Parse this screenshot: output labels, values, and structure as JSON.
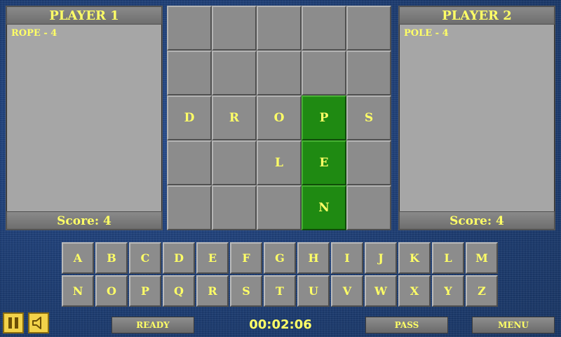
{
  "player1": {
    "title": "PLAYER 1",
    "words": [
      "ROPE - 4"
    ],
    "score": "Score: 4"
  },
  "player2": {
    "title": "PLAYER 2",
    "words": [
      "POLE - 4"
    ],
    "score": "Score: 4"
  },
  "board": {
    "rows": [
      [
        "",
        "",
        "",
        "",
        ""
      ],
      [
        "",
        "",
        "",
        "",
        ""
      ],
      [
        "D",
        "R",
        "O",
        "P",
        "S"
      ],
      [
        "",
        "",
        "L",
        "E",
        ""
      ],
      [
        "",
        "",
        "",
        "N",
        ""
      ]
    ],
    "highlighted": [
      [
        2,
        3
      ],
      [
        3,
        3
      ],
      [
        4,
        3
      ]
    ]
  },
  "keyboard": {
    "rows": [
      [
        "A",
        "B",
        "C",
        "D",
        "E",
        "F",
        "G",
        "H",
        "I",
        "J",
        "K",
        "L",
        "M"
      ],
      [
        "N",
        "O",
        "P",
        "Q",
        "R",
        "S",
        "T",
        "U",
        "V",
        "W",
        "X",
        "Y",
        "Z"
      ]
    ]
  },
  "controls": {
    "pause_icon": "pause-icon",
    "sound_icon": "speaker-icon",
    "ready_label": "READY",
    "timer": "00:02:06",
    "pass_label": "PASS",
    "menu_label": "MENU"
  },
  "colors": {
    "text_yellow": "#ffff66",
    "tile_gray": "#8c8c8c",
    "tile_green": "#1f8a12",
    "background_blue": "#1d3f78",
    "icon_button_yellow": "#f2d24a"
  }
}
